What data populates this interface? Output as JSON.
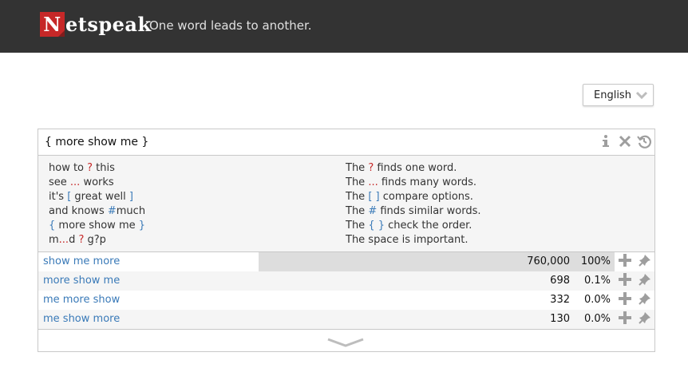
{
  "header": {
    "logo_initial": "N",
    "logo_rest": "etspeak",
    "slogan": "One word leads to another."
  },
  "language_select": {
    "value": "English"
  },
  "query": {
    "value": "{ more show me }"
  },
  "help": {
    "examples": [
      {
        "a": "how to ",
        "op": "?",
        "b": " this",
        "op_color": "red"
      },
      {
        "a": "see ",
        "op": "...",
        "b": " works",
        "op_color": "red"
      },
      {
        "a": "it's ",
        "op": "[",
        "b": " great well ",
        "op2": "]",
        "op_color": "blue"
      },
      {
        "a": "and knows ",
        "op": "#",
        "b": "much",
        "op_color": "blue"
      },
      {
        "a": "",
        "op": "{",
        "b": " more show me ",
        "op2": "}",
        "op_color": "blue"
      },
      {
        "a": "m",
        "op": "...",
        "b": "d ",
        "op3": "?",
        "c": " g?p",
        "op_color": "red"
      }
    ],
    "explanations": [
      {
        "a": "The ",
        "op": "?",
        "b": " finds one word."
      },
      {
        "a": "The ",
        "op": "...",
        "b": " finds many words."
      },
      {
        "a": "The ",
        "op": "[ ]",
        "b": " compare options."
      },
      {
        "a": "The ",
        "op": "#",
        "b": " finds similar words."
      },
      {
        "a": "The ",
        "op": "{ }",
        "b": " check the order."
      },
      {
        "a": "The space is important.",
        "op": "",
        "b": ""
      }
    ]
  },
  "results": [
    {
      "phrase": "show me more",
      "count": "760,000",
      "percent": "100%",
      "share": 1.0
    },
    {
      "phrase": "more show me",
      "count": "698",
      "percent": "0.1%",
      "share": 0.0
    },
    {
      "phrase": "me more show",
      "count": "332",
      "percent": "0.0%",
      "share": 0.0
    },
    {
      "phrase": "me show more",
      "count": "130",
      "percent": "0.0%",
      "share": 0.0
    }
  ]
}
